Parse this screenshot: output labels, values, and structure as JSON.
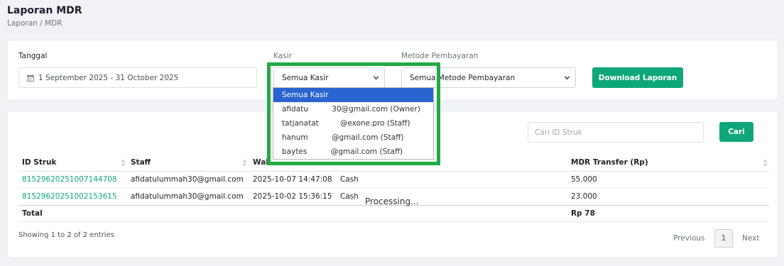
{
  "header": {
    "title": "Laporan MDR",
    "breadcrumb": "Laporan / MDR"
  },
  "filters": {
    "tanggal_label": "Tanggal",
    "date_range": "1 September 2025 - 31 October 2025",
    "kasir_label": "Kasir",
    "kasir_selected": "Semua Kasir",
    "metode_label": "Metode Pembayaran",
    "metode_selected": "Semua Metode Pembayaran",
    "download_label": "Download Laporan"
  },
  "kasir_dropdown": {
    "options": [
      "Semua Kasir",
      "afidatu          30@gmail.com (Owner)",
      "tatjanatat         @exone.pro (Staff)",
      "hanum          @gmail.com (Staff)",
      "baytes          @gmail.com (Staff)"
    ],
    "selected_index": 0
  },
  "search": {
    "placeholder": "Cari ID Struk",
    "button_label": "Cari"
  },
  "table": {
    "columns": [
      "ID Struk",
      "Staff",
      "Wak",
      "MDR Transfer (Rp)"
    ],
    "rows": [
      {
        "id": "81529620251007144708",
        "staff": "afidatulummah30@gmail.com",
        "waktu": "2025-10-07 14:47:08",
        "metode": "Cash",
        "mdr": "55.000"
      },
      {
        "id": "81529620251002153615",
        "staff": "afidatulummah30@gmail.com",
        "waktu": "2025-10-02 15:36:15",
        "metode": "Cash",
        "mdr": "23.000"
      }
    ],
    "total_label": "Total",
    "total_value": "Rp 78"
  },
  "processing_text": "Processing...",
  "pagination": {
    "info": "Showing 1 to 2 of 2 entries",
    "previous": "Previous",
    "current_page": "1",
    "next": "Next"
  },
  "colors": {
    "accent": "#0fa77a",
    "dropdown_selected": "#2a64d0",
    "highlight_border": "#22aa44"
  },
  "icons": {
    "date": "calendar-icon",
    "select": "chevron-down-icon",
    "sort": "sort-icon"
  }
}
